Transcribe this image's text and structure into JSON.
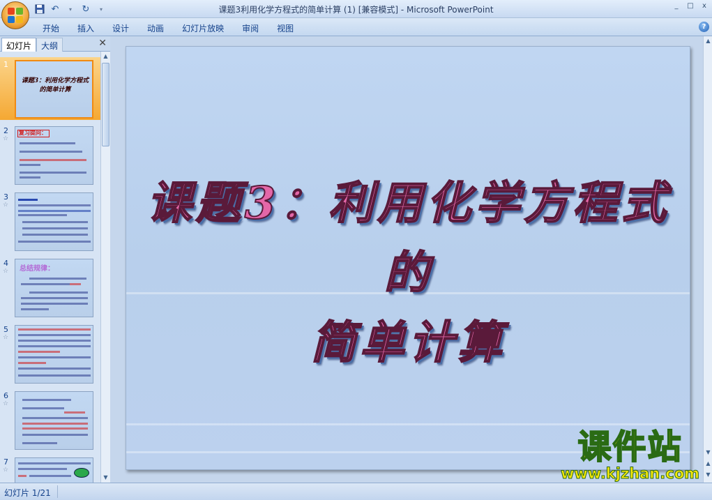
{
  "window": {
    "title": "课题3利用化学方程式的简单计算 (1) [兼容模式] - Microsoft PowerPoint",
    "minimize": "_",
    "maximize": "□",
    "close": "x"
  },
  "quick_access": {
    "save_icon": "save-icon",
    "undo_icon": "undo-icon",
    "redo_icon": "redo-icon",
    "customize_icon": "dropdown-icon"
  },
  "ribbon": {
    "tabs": [
      "开始",
      "插入",
      "设计",
      "动画",
      "幻灯片放映",
      "审阅",
      "视图"
    ],
    "help": "?"
  },
  "left_pane": {
    "tab_slides": "幻灯片",
    "tab_outline": "大纲",
    "close": "✕",
    "thumbnails": [
      {
        "number": "1",
        "title": "课题3：利用化学方程式的简单计算"
      },
      {
        "number": "2",
        "heading": "复习提问："
      },
      {
        "number": "3"
      },
      {
        "number": "4",
        "heading": "总结规律："
      },
      {
        "number": "5"
      },
      {
        "number": "6"
      },
      {
        "number": "7"
      }
    ]
  },
  "slide": {
    "title_line1": "课题3：利用化学方程式的",
    "title_line2": "简单计算"
  },
  "watermark": {
    "name": "课件站",
    "url": "www.kjzhan.com"
  },
  "status": {
    "slide_indicator": "幻灯片 1/21"
  }
}
